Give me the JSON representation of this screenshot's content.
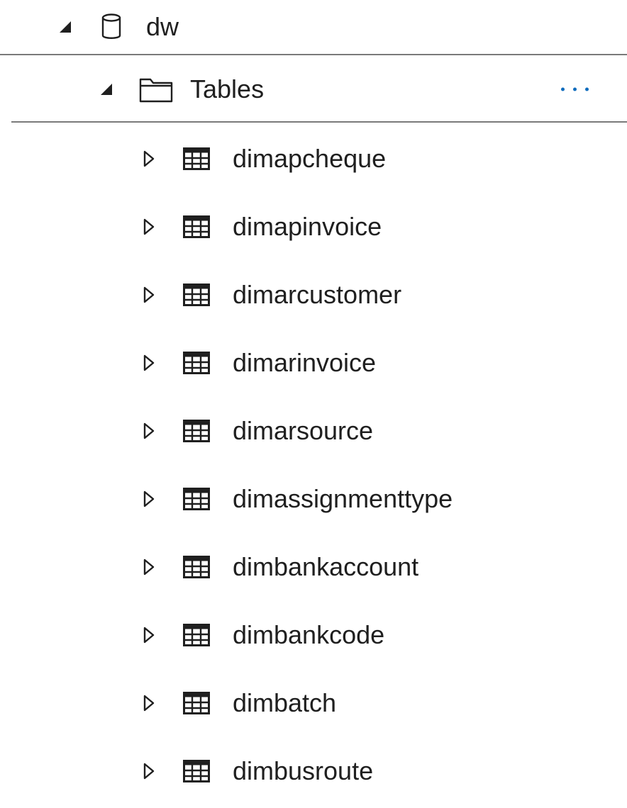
{
  "tree": {
    "database": {
      "label": "dw",
      "expanded": true,
      "icon": "database-icon"
    },
    "folder": {
      "label": "Tables",
      "expanded": true,
      "icon": "folder-icon",
      "more_icon": "more-options-icon"
    },
    "tables": [
      {
        "label": "dimapcheque",
        "expanded": false,
        "icon": "table-icon"
      },
      {
        "label": "dimapinvoice",
        "expanded": false,
        "icon": "table-icon"
      },
      {
        "label": "dimarcustomer",
        "expanded": false,
        "icon": "table-icon"
      },
      {
        "label": "dimarinvoice",
        "expanded": false,
        "icon": "table-icon"
      },
      {
        "label": "dimarsource",
        "expanded": false,
        "icon": "table-icon"
      },
      {
        "label": "dimassignmenttype",
        "expanded": false,
        "icon": "table-icon"
      },
      {
        "label": "dimbankaccount",
        "expanded": false,
        "icon": "table-icon"
      },
      {
        "label": "dimbankcode",
        "expanded": false,
        "icon": "table-icon"
      },
      {
        "label": "dimbatch",
        "expanded": false,
        "icon": "table-icon"
      },
      {
        "label": "dimbusroute",
        "expanded": false,
        "icon": "table-icon"
      }
    ]
  },
  "colors": {
    "text": "#1f1f1f",
    "divider": "#7a7a7a",
    "accent": "#0f6cbd"
  }
}
